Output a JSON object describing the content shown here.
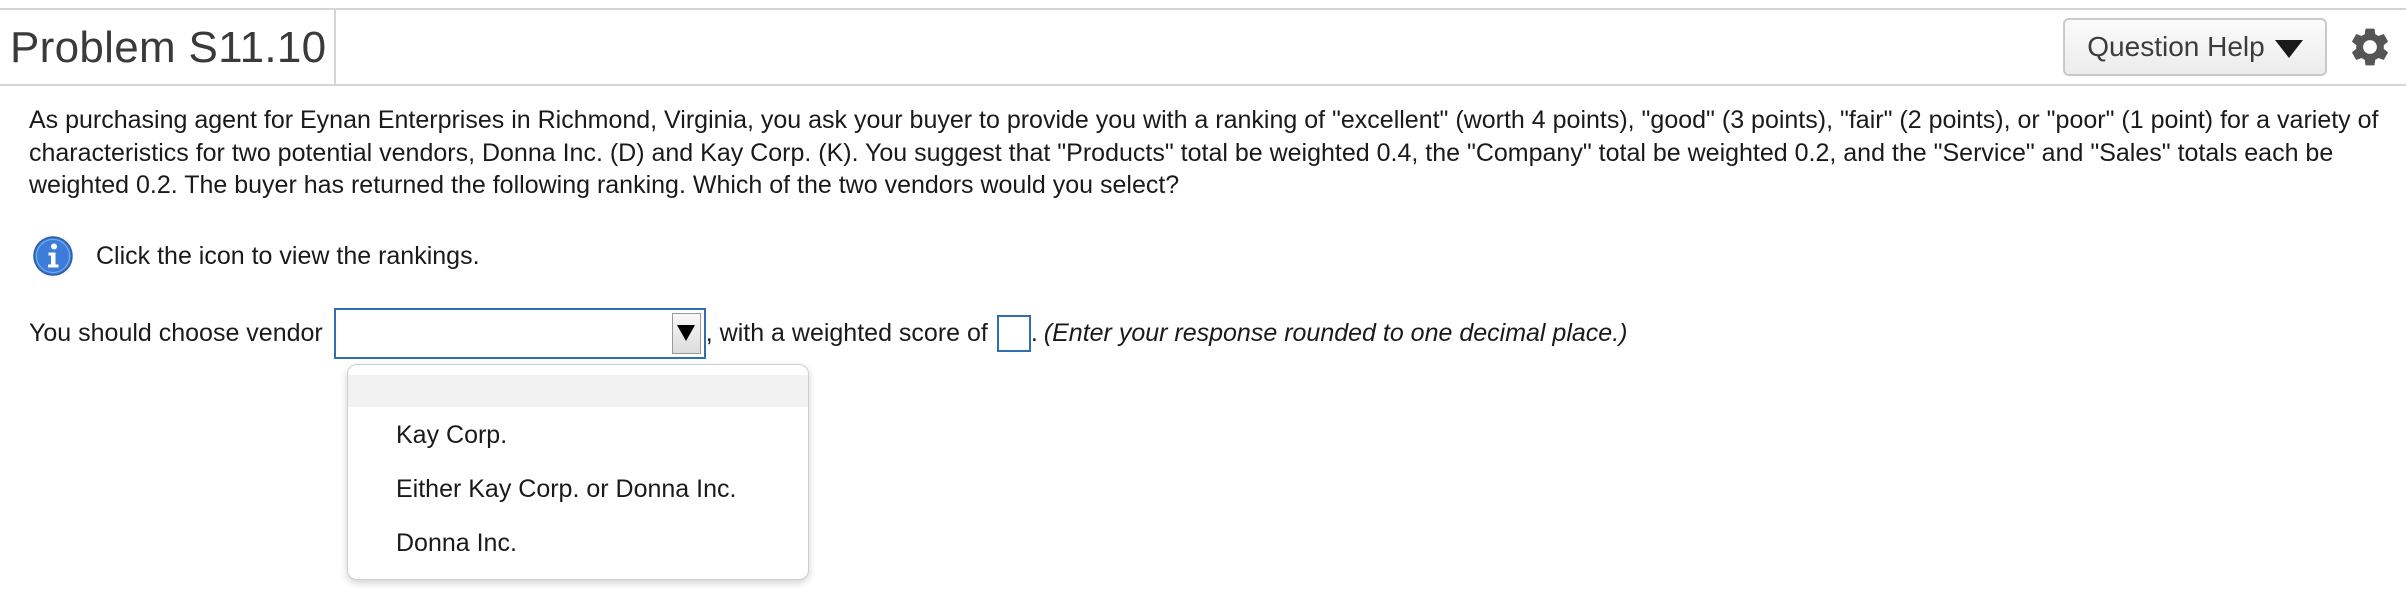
{
  "header": {
    "title": "Problem S11.10",
    "help_label": "Question Help"
  },
  "problem_text": "As purchasing agent for Eynan Enterprises in Richmond, Virginia, you ask your buyer to provide you with a ranking of \"excellent\" (worth 4 points), \"good\" (3 points), \"fair\" (2 points), or \"poor\"  (1 point) for a variety of characteristics for two potential vendors, Donna Inc. (D) and Kay Corp. (K). You suggest that \"Products\" total be weighted 0.4, the \"Company\" total be weighted 0.2, and the \"Service\" and \"Sales\" totals each be weighted 0.2. The buyer has returned the following ranking. Which of the two vendors would you select?",
  "info": {
    "text": "Click the icon to view the rankings."
  },
  "answer": {
    "prefix": "You should choose vendor",
    "selected_value": "",
    "middle": ", with a weighted score of",
    "score_value": "",
    "suffix": ".",
    "instruction": "(Enter your response rounded to one decimal place.)"
  },
  "dropdown": {
    "options": [
      "",
      "Kay Corp.",
      "Either Kay Corp. or Donna Inc.",
      "Donna Inc."
    ]
  },
  "colors": {
    "input_border": "#2f6fb0",
    "info_icon": "#3b7dd8",
    "divider": "#d6d6d6"
  },
  "icons": {
    "help_caret": "caret-down-icon",
    "settings": "gear-icon",
    "info": "info-icon",
    "select_arrow": "triangle-down-icon"
  }
}
